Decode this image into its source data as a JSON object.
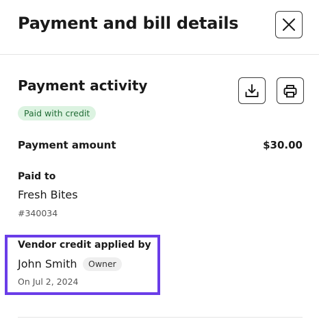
{
  "header": {
    "title": "Payment and bill details",
    "close_icon": "close-icon"
  },
  "payment_activity": {
    "title": "Payment activity",
    "status_badge": "Paid with credit",
    "status_colors": {
      "background": "#dcf3e1",
      "text": "#1f6b34"
    },
    "actions": [
      {
        "icon": "download-icon"
      },
      {
        "icon": "print-icon"
      }
    ]
  },
  "payment_amount": {
    "label": "Payment amount",
    "value": "$30.00"
  },
  "paid_to": {
    "label": "Paid to",
    "name": "Fresh Bites",
    "id": "#340034"
  },
  "vendor_credit": {
    "label": "Vendor credit applied by",
    "name": "John Smith",
    "role": "Owner",
    "date": "On Jul 2, 2024",
    "highlight_color": "#6a3de8"
  }
}
